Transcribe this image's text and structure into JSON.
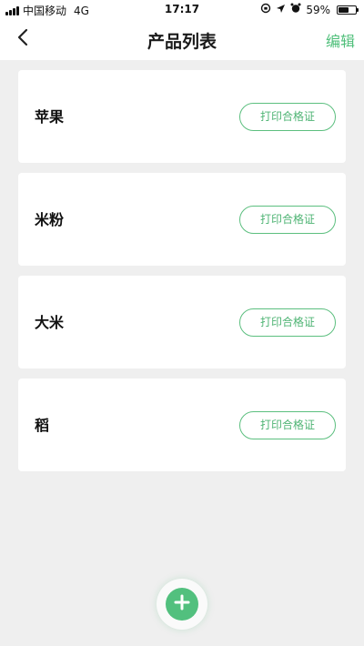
{
  "status_bar": {
    "carrier": "中国移动",
    "network": "4G",
    "time": "17:17",
    "battery_percent": "59%",
    "battery_level": 0.59
  },
  "nav": {
    "title": "产品列表",
    "edit_label": "编辑"
  },
  "products": [
    {
      "name": "苹果",
      "button_label": "打印合格证"
    },
    {
      "name": "米粉",
      "button_label": "打印合格证"
    },
    {
      "name": "大米",
      "button_label": "打印合格证"
    },
    {
      "name": "稻",
      "button_label": "打印合格证"
    }
  ],
  "colors": {
    "accent": "#52c07e",
    "background": "#efefef",
    "card": "#ffffff"
  },
  "icons": {
    "back": "chevron-left-icon",
    "add": "plus-icon"
  }
}
